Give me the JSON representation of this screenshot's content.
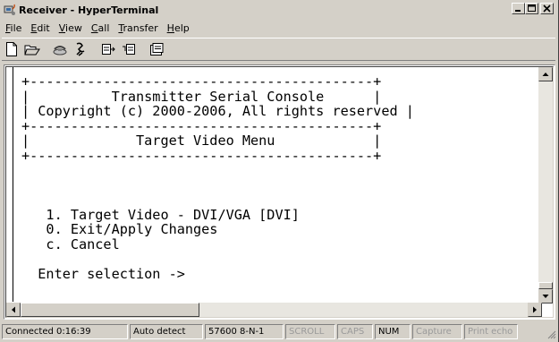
{
  "window": {
    "title": "Receiver - HyperTerminal"
  },
  "menu": {
    "items": [
      {
        "pre": "",
        "ul": "F",
        "post": "ile"
      },
      {
        "pre": "",
        "ul": "E",
        "post": "dit"
      },
      {
        "pre": "",
        "ul": "V",
        "post": "iew"
      },
      {
        "pre": "",
        "ul": "C",
        "post": "all"
      },
      {
        "pre": "",
        "ul": "T",
        "post": "ransfer"
      },
      {
        "pre": "",
        "ul": "H",
        "post": "elp"
      }
    ]
  },
  "toolbar": {
    "icons": [
      "new-icon",
      "open-icon",
      "connect-icon",
      "disconnect-icon",
      "send-icon",
      "receive-icon",
      "properties-icon"
    ]
  },
  "terminal": {
    "lines": [
      "+------------------------------------------+",
      "|          Transmitter Serial Console      |",
      "| Copyright (c) 2000-2006, All rights reserved |",
      "+------------------------------------------+",
      "|             Target Video Menu            |",
      "+------------------------------------------+",
      "",
      "",
      "",
      "   1. Target Video - DVI/VGA [DVI]",
      "   0. Exit/Apply Changes",
      "   c. Cancel",
      "",
      "  Enter selection ->"
    ]
  },
  "status": {
    "connected": "Connected 0:16:39",
    "detect": "Auto detect",
    "settings": "57600 8-N-1",
    "scroll": "SCROLL",
    "caps": "CAPS",
    "num": "NUM",
    "capture": "Capture",
    "print": "Print echo"
  },
  "colors": {
    "face": "#d4d0c8",
    "terminal_bg": "#ffffff",
    "text": "#000000"
  }
}
